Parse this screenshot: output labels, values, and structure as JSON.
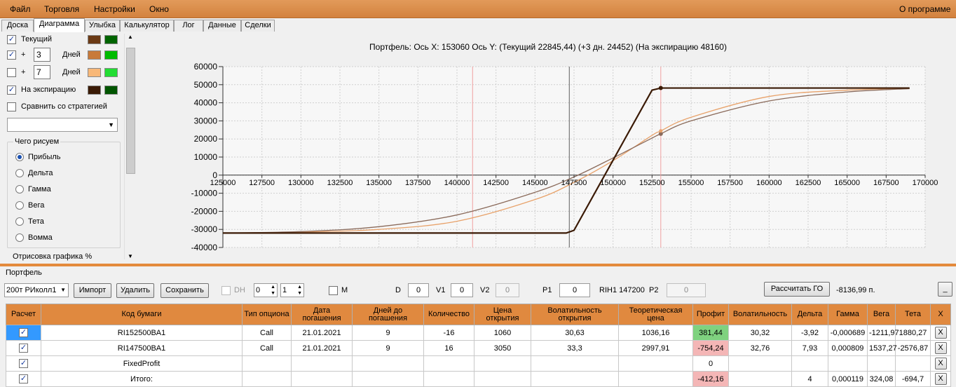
{
  "menu": {
    "items": [
      "Файл",
      "Торговля",
      "Настройки",
      "Окно"
    ],
    "about": "О программе"
  },
  "tabs": [
    "Доска",
    "Диаграмма",
    "Улыбка",
    "Калькулятор",
    "Лог",
    "Данные",
    "Сделки"
  ],
  "left": {
    "current": {
      "label": "Текущий",
      "checked": true,
      "c1": "#6b3a15",
      "c2": "#006400"
    },
    "plus1": {
      "label": "Дней",
      "days": "3",
      "sign": "+",
      "checked": true,
      "c1": "#c87a3a",
      "c2": "#00bb00"
    },
    "plus2": {
      "label": "Дней",
      "days": "7",
      "sign": "+",
      "checked": false,
      "c1": "#f8b878",
      "c2": "#22dd33"
    },
    "expiry": {
      "label": "На экспирацию",
      "checked": true,
      "c1": "#3a1a05",
      "c2": "#005500"
    },
    "compare": {
      "label": "Сравнить со стратегией",
      "checked": false
    },
    "group_title": "Чего рисуем",
    "radios": [
      "Прибыль",
      "Дельта",
      "Гамма",
      "Вега",
      "Тета",
      "Вомма"
    ],
    "selected": "Прибыль",
    "render_label": "Отрисовка графика %"
  },
  "chart_header": "Портфель: Ось X: 153060 Ось Y:  (Текущий 22845,44)  (+3 дн. 24452)  (На экспирацию 48160)",
  "chart_data": {
    "type": "line",
    "x_ticks": [
      125000,
      127500,
      130000,
      132500,
      135000,
      137500,
      140000,
      142500,
      145000,
      147500,
      150000,
      152500,
      155000,
      157500,
      160000,
      162500,
      165000,
      167500,
      170000
    ],
    "y_ticks": [
      60000,
      50000,
      40000,
      30000,
      20000,
      10000,
      0,
      -10000,
      -20000,
      -30000,
      -40000
    ],
    "xlim": [
      125000,
      170000
    ],
    "ylim": [
      -40000,
      60000
    ],
    "grid": true,
    "markers": {
      "vertical": [
        147200
      ],
      "red_vertical": [
        141000,
        153060
      ]
    },
    "series": [
      {
        "color": "#3a1a05",
        "x": [
          125000,
          142500,
          147000,
          147500,
          152500,
          153060,
          169000
        ],
        "y": [
          -32000,
          -32000,
          -32000,
          -30500,
          47000,
          48160,
          48160
        ]
      },
      {
        "color": "#8a6a5a",
        "x": [
          125000,
          130000,
          135000,
          140000,
          145000,
          147500,
          150000,
          152500,
          153060,
          155000,
          160000,
          165000,
          169000
        ],
        "y": [
          -32000,
          -31200,
          -28500,
          -22000,
          -9500,
          -1000,
          9500,
          20500,
          22845,
          30000,
          41000,
          46000,
          47800
        ]
      },
      {
        "color": "#e8a26a",
        "x": [
          125000,
          130000,
          135000,
          140000,
          145000,
          147500,
          150000,
          152500,
          153060,
          155000,
          160000,
          165000,
          169000
        ],
        "y": [
          -32000,
          -31500,
          -30000,
          -25500,
          -13500,
          -4000,
          8000,
          22000,
          24452,
          32000,
          43500,
          47000,
          48000
        ]
      }
    ]
  },
  "portfolio": {
    "title": "Портфель",
    "selector": "200т РИколл1",
    "buttons": {
      "import": "Импорт",
      "delete": "Удалить",
      "save": "Сохранить",
      "calc_go": "Рассчитать ГО",
      "collapse": "_"
    },
    "dh_label": "DH",
    "spin1": "0",
    "spin2": "1",
    "m_label": "M",
    "d_label": "D",
    "d_val": "0",
    "v1_label": "V1",
    "v1_val": "0",
    "v2_label": "V2",
    "v2_val": "0",
    "p1_label": "P1",
    "p1_val": "0",
    "rih_label": "RIH1 147200",
    "p2_label": "P2",
    "p2_val": "0",
    "go_value": "-8136,99 п."
  },
  "table": {
    "headers": [
      "Расчет",
      "Код бумаги",
      "Тип опциона",
      "Дата погашения",
      "Дней до погашения",
      "Количество",
      "Цена открытия",
      "Волатильность открытия",
      "Теоретическая цена",
      "Профит",
      "Волатильность",
      "Дельта",
      "Гамма",
      "Вега",
      "Тета",
      "X"
    ],
    "rows": [
      [
        "✓",
        "RI152500BA1",
        "Call",
        "21.01.2021",
        "9",
        "-16",
        "1060",
        "30,63",
        "1036,16",
        "381,44",
        "30,32",
        "-3,92",
        "-0,000689",
        "-1211,97",
        "1880,27",
        "X"
      ],
      [
        "✓",
        "RI147500BA1",
        "Call",
        "21.01.2021",
        "9",
        "16",
        "3050",
        "33,3",
        "2997,91",
        "-754,24",
        "32,76",
        "7,93",
        "0,000809",
        "1537,27",
        "-2576,87",
        "X"
      ],
      [
        "✓",
        "FixedProfit",
        "",
        "",
        "",
        "",
        "",
        "",
        "",
        "0",
        "",
        "",
        "",
        "",
        "",
        "X"
      ],
      [
        "✓",
        "Итого:",
        "",
        "",
        "",
        "",
        "",
        "",
        "",
        "-412,16",
        "",
        "4",
        "0,000119",
        "324,08",
        "-694,7",
        "X"
      ]
    ],
    "profit_colors": [
      "#7fd27f",
      "#f4b6b6",
      "#ffffff",
      "#f4b6b6"
    ]
  }
}
